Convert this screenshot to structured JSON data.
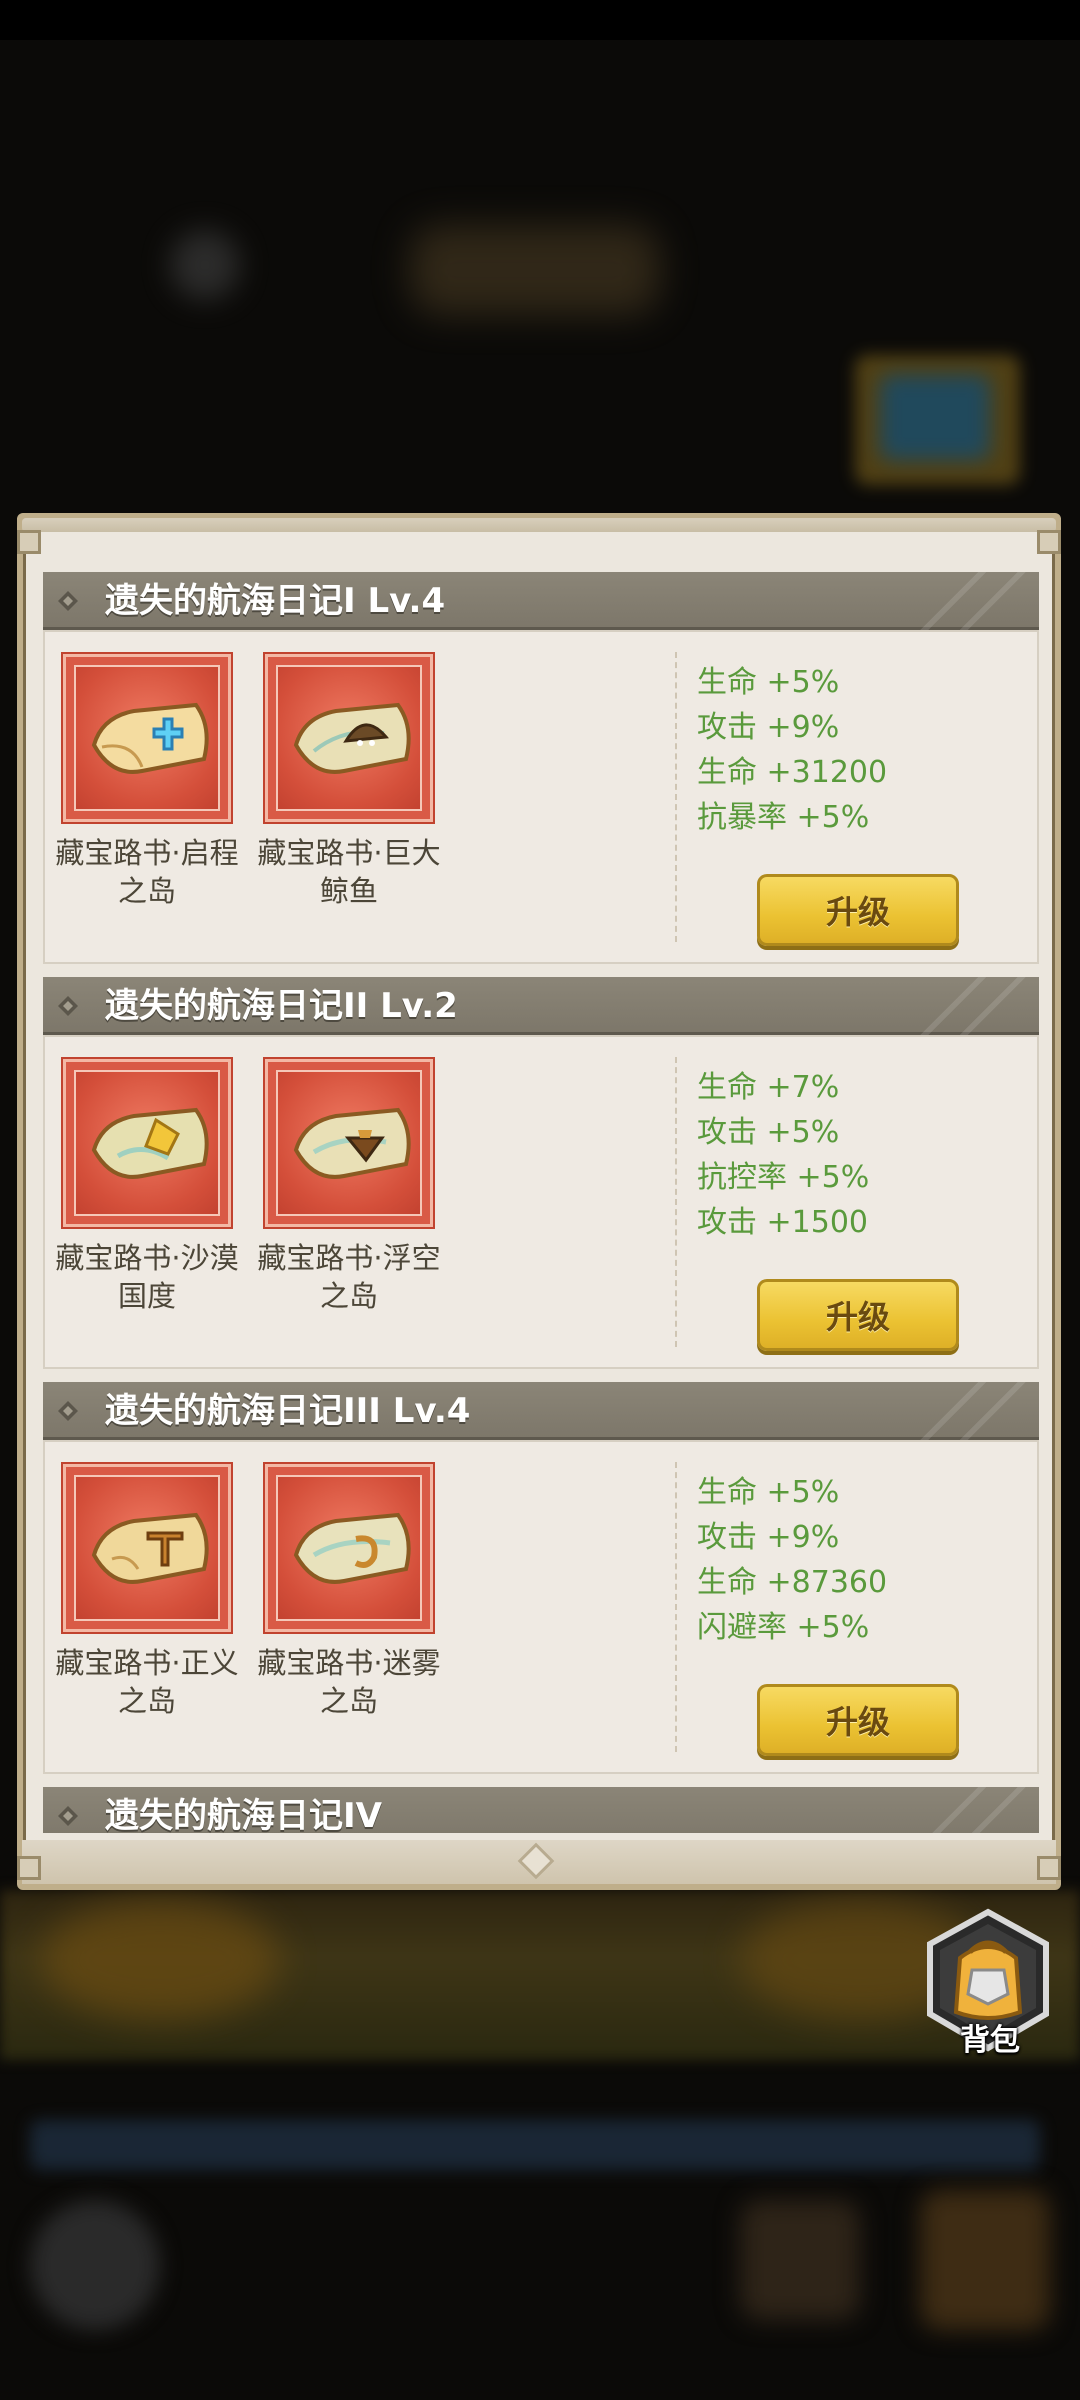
{
  "sections": [
    {
      "title": "遗失的航海日记I Lv.4",
      "items": [
        {
          "name_line1": "藏宝路书·启程",
          "name_line2": "之岛",
          "icon": "treasure-map-cross-icon"
        },
        {
          "name_line1": "藏宝路书·巨大",
          "name_line2": "鲸鱼",
          "icon": "treasure-map-whale-icon"
        }
      ],
      "stats": [
        "生命 +5%",
        "攻击 +9%",
        "生命 +31200",
        "抗暴率 +5%"
      ],
      "button": "升级"
    },
    {
      "title": "遗失的航海日记II Lv.2",
      "items": [
        {
          "name_line1": "藏宝路书·沙漠",
          "name_line2": "国度",
          "icon": "treasure-map-desert-icon"
        },
        {
          "name_line1": "藏宝路书·浮空",
          "name_line2": "之岛",
          "icon": "treasure-map-floating-island-icon"
        }
      ],
      "stats": [
        "生命 +7%",
        "攻击 +5%",
        "抗控率 +5%",
        "攻击 +1500"
      ],
      "button": "升级"
    },
    {
      "title": "遗失的航海日记III Lv.4",
      "items": [
        {
          "name_line1": "藏宝路书·正义",
          "name_line2": "之岛",
          "icon": "treasure-map-justice-icon"
        },
        {
          "name_line1": "藏宝路书·迷雾",
          "name_line2": "之岛",
          "icon": "treasure-map-fog-icon"
        }
      ],
      "stats": [
        "生命 +5%",
        "攻击 +9%",
        "生命 +87360",
        "闪避率 +5%"
      ],
      "button": "升级"
    },
    {
      "title": "遗失的航海日记IV"
    }
  ],
  "backpack": {
    "label": "背包",
    "icon": "backpack-icon"
  },
  "colors": {
    "stat_green": "#5a9a3c",
    "button_yellow": "#ebc232",
    "item_red": "#d95a46",
    "header_gray": "#847e71"
  }
}
